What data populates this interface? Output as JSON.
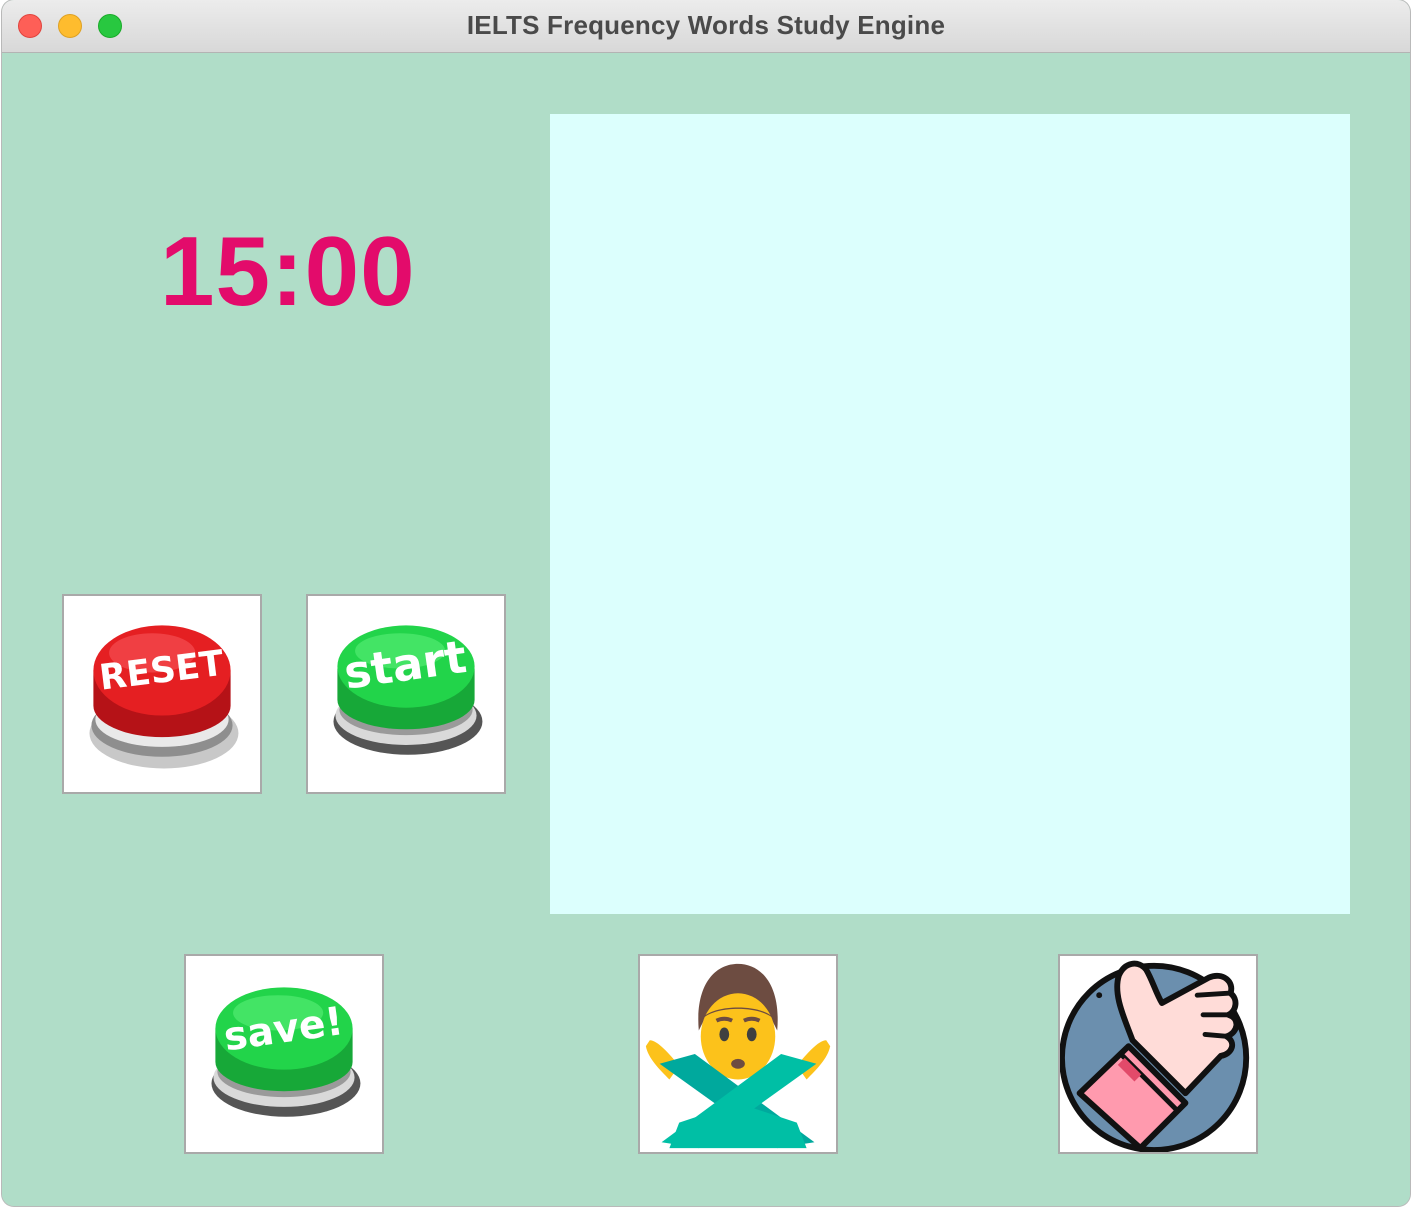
{
  "window": {
    "title": "IELTS Frequency Words Study Engine",
    "controls": [
      "close",
      "minimize",
      "maximize"
    ]
  },
  "timer": {
    "value": "15:00",
    "color": "#e30b6b"
  },
  "word_display": {
    "background": "#dcfffd",
    "text": ""
  },
  "buttons": {
    "reset": {
      "label": "RESET",
      "icon": "red-reset-push-button",
      "color": "#e51f22"
    },
    "start": {
      "label": "start",
      "icon": "green-start-push-button",
      "color": "#22d44a"
    },
    "save": {
      "label": "save!",
      "icon": "green-save-push-button",
      "color": "#22d44a"
    },
    "reject": {
      "icon": "man-gesturing-no-emoji"
    },
    "approve": {
      "icon": "thumbs-up-hand-icon"
    }
  },
  "colors": {
    "window_background": "#b0ddc8"
  }
}
